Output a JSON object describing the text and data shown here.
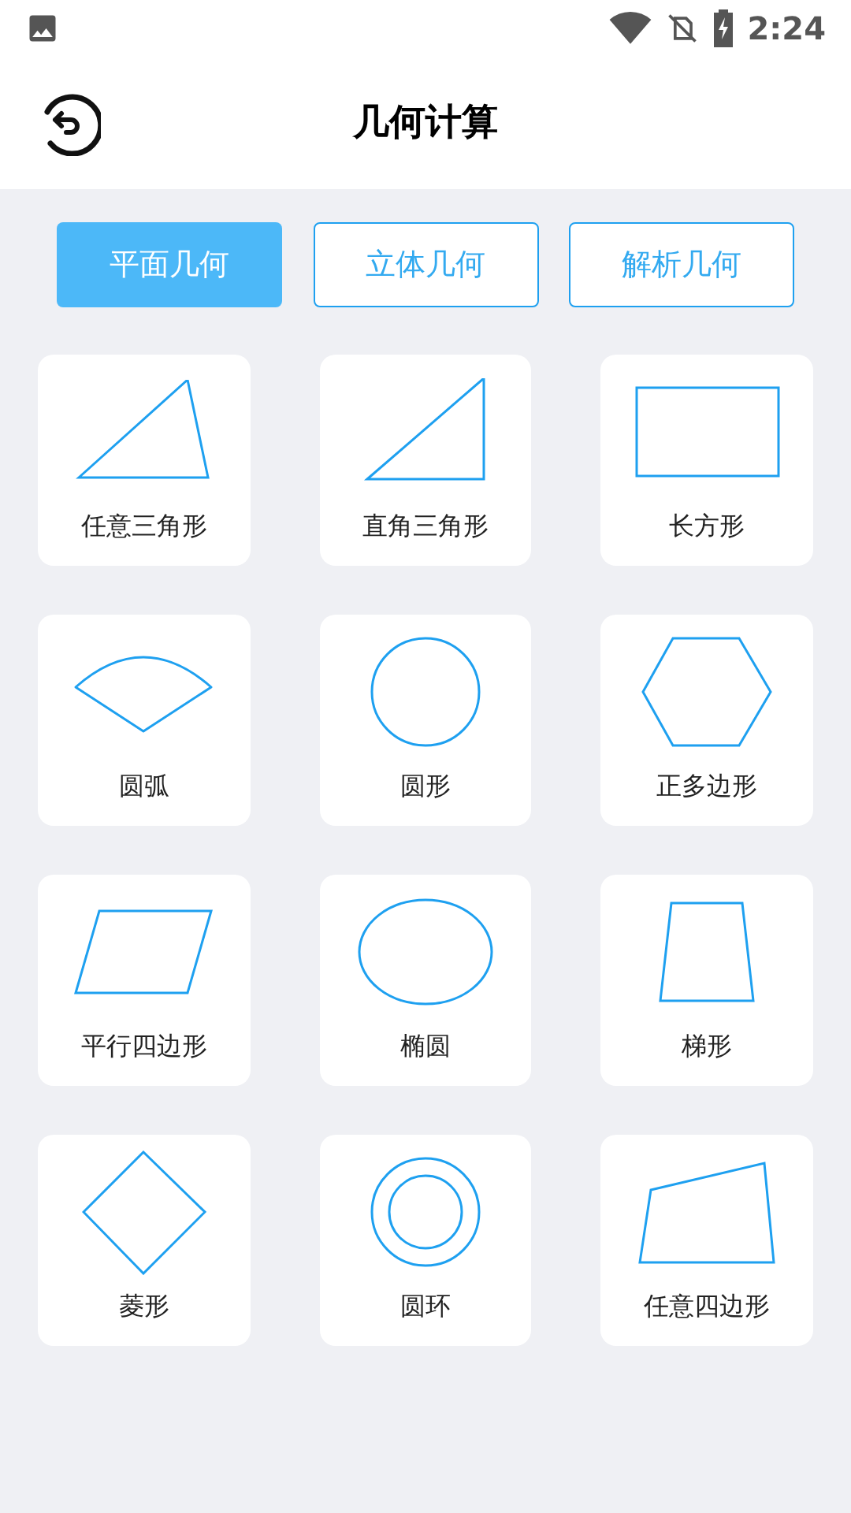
{
  "status_bar": {
    "time": "2:24"
  },
  "header": {
    "title": "几何计算"
  },
  "tabs": [
    {
      "label": "平面几何",
      "selected": true
    },
    {
      "label": "立体几何",
      "selected": false
    },
    {
      "label": "解析几何",
      "selected": false
    }
  ],
  "shapes": [
    {
      "kind": "triangle",
      "label": "任意三角形"
    },
    {
      "kind": "right-triangle",
      "label": "直角三角形"
    },
    {
      "kind": "rectangle",
      "label": "长方形"
    },
    {
      "kind": "arc",
      "label": "圆弧"
    },
    {
      "kind": "circle",
      "label": "圆形"
    },
    {
      "kind": "hexagon",
      "label": "正多边形"
    },
    {
      "kind": "parallelogram",
      "label": "平行四边形"
    },
    {
      "kind": "ellipse",
      "label": "椭圆"
    },
    {
      "kind": "trapezoid",
      "label": "梯形"
    },
    {
      "kind": "rhombus",
      "label": "菱形"
    },
    {
      "kind": "ring",
      "label": "圆环"
    },
    {
      "kind": "quadrilateral",
      "label": "任意四边形"
    }
  ]
}
